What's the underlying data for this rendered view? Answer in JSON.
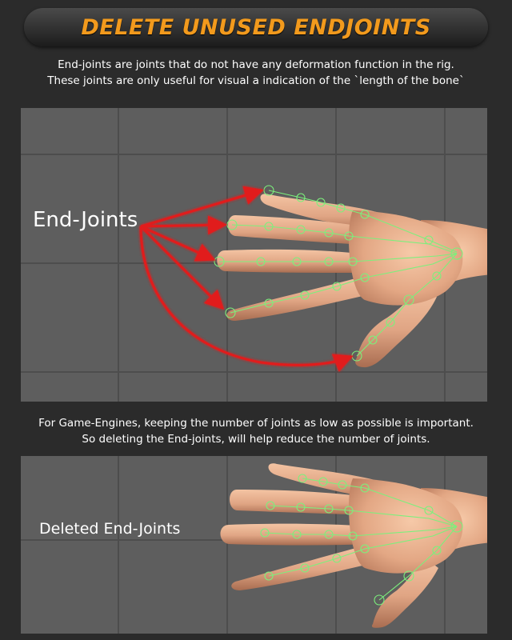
{
  "title": "DELETE UNUSED ENDJOINTS",
  "intro": {
    "line1": "End-joints are joints that do not have any deformation function in the rig.",
    "line2": "These joints are only useful for visual a indication of the `length of the bone`"
  },
  "viewport1": {
    "label": "End-Joints"
  },
  "middle": {
    "line1": "For Game-Engines, keeping the number of joints as low as possible is important.",
    "line2": "So deleting the End-joints, will help reduce the number of joints."
  },
  "viewport2": {
    "label": "Deleted End-Joints"
  },
  "colors": {
    "title": "#f29a1d",
    "viewport_bg": "#5e5e5e",
    "grid": "#4d4d4d",
    "skin": "#e0a584",
    "joint": "#7cf07c",
    "arrow": "#e11d1d"
  }
}
